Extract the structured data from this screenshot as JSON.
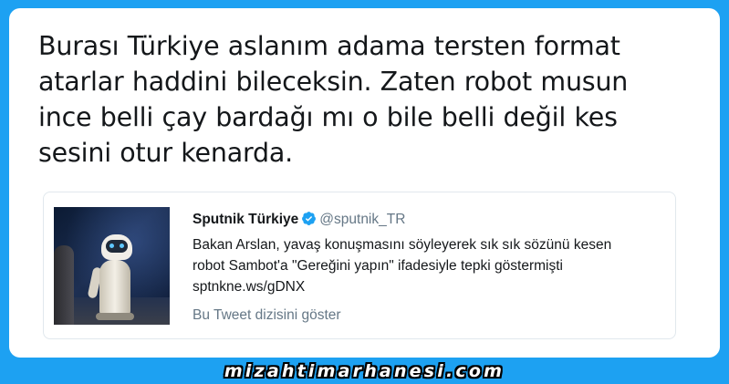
{
  "tweet": {
    "text_lines": [
      "Burası Türkiye aslanım adama tersten format",
      "atarlar haddini bileceksin. Zaten robot musun",
      "ince belli çay bardağı mı o bile belli değil kes",
      "sesini otur kenarda."
    ]
  },
  "quoted_tweet": {
    "author_name": "Sputnik Türkiye",
    "handle": "@sputnik_TR",
    "verified_icon": "verified-badge-icon",
    "text_lines": [
      "Bakan Arslan, yavaş konuşmasını söyleyerek sık sık sözünü kesen",
      "robot Sambot'a \"Gereğini yapın\" ifadesiyle tepki göstermişti",
      "sptnkne.ws/gDNX"
    ],
    "thread_link_label": "Bu Tweet dizisini göster"
  },
  "watermark": {
    "text": "mizahtimarhanesi.com"
  },
  "colors": {
    "background": "#1da1f2",
    "card": "#ffffff",
    "text_primary": "#14171a",
    "text_secondary": "#657786",
    "border": "#e1e8ed",
    "verified": "#1da1f2"
  }
}
